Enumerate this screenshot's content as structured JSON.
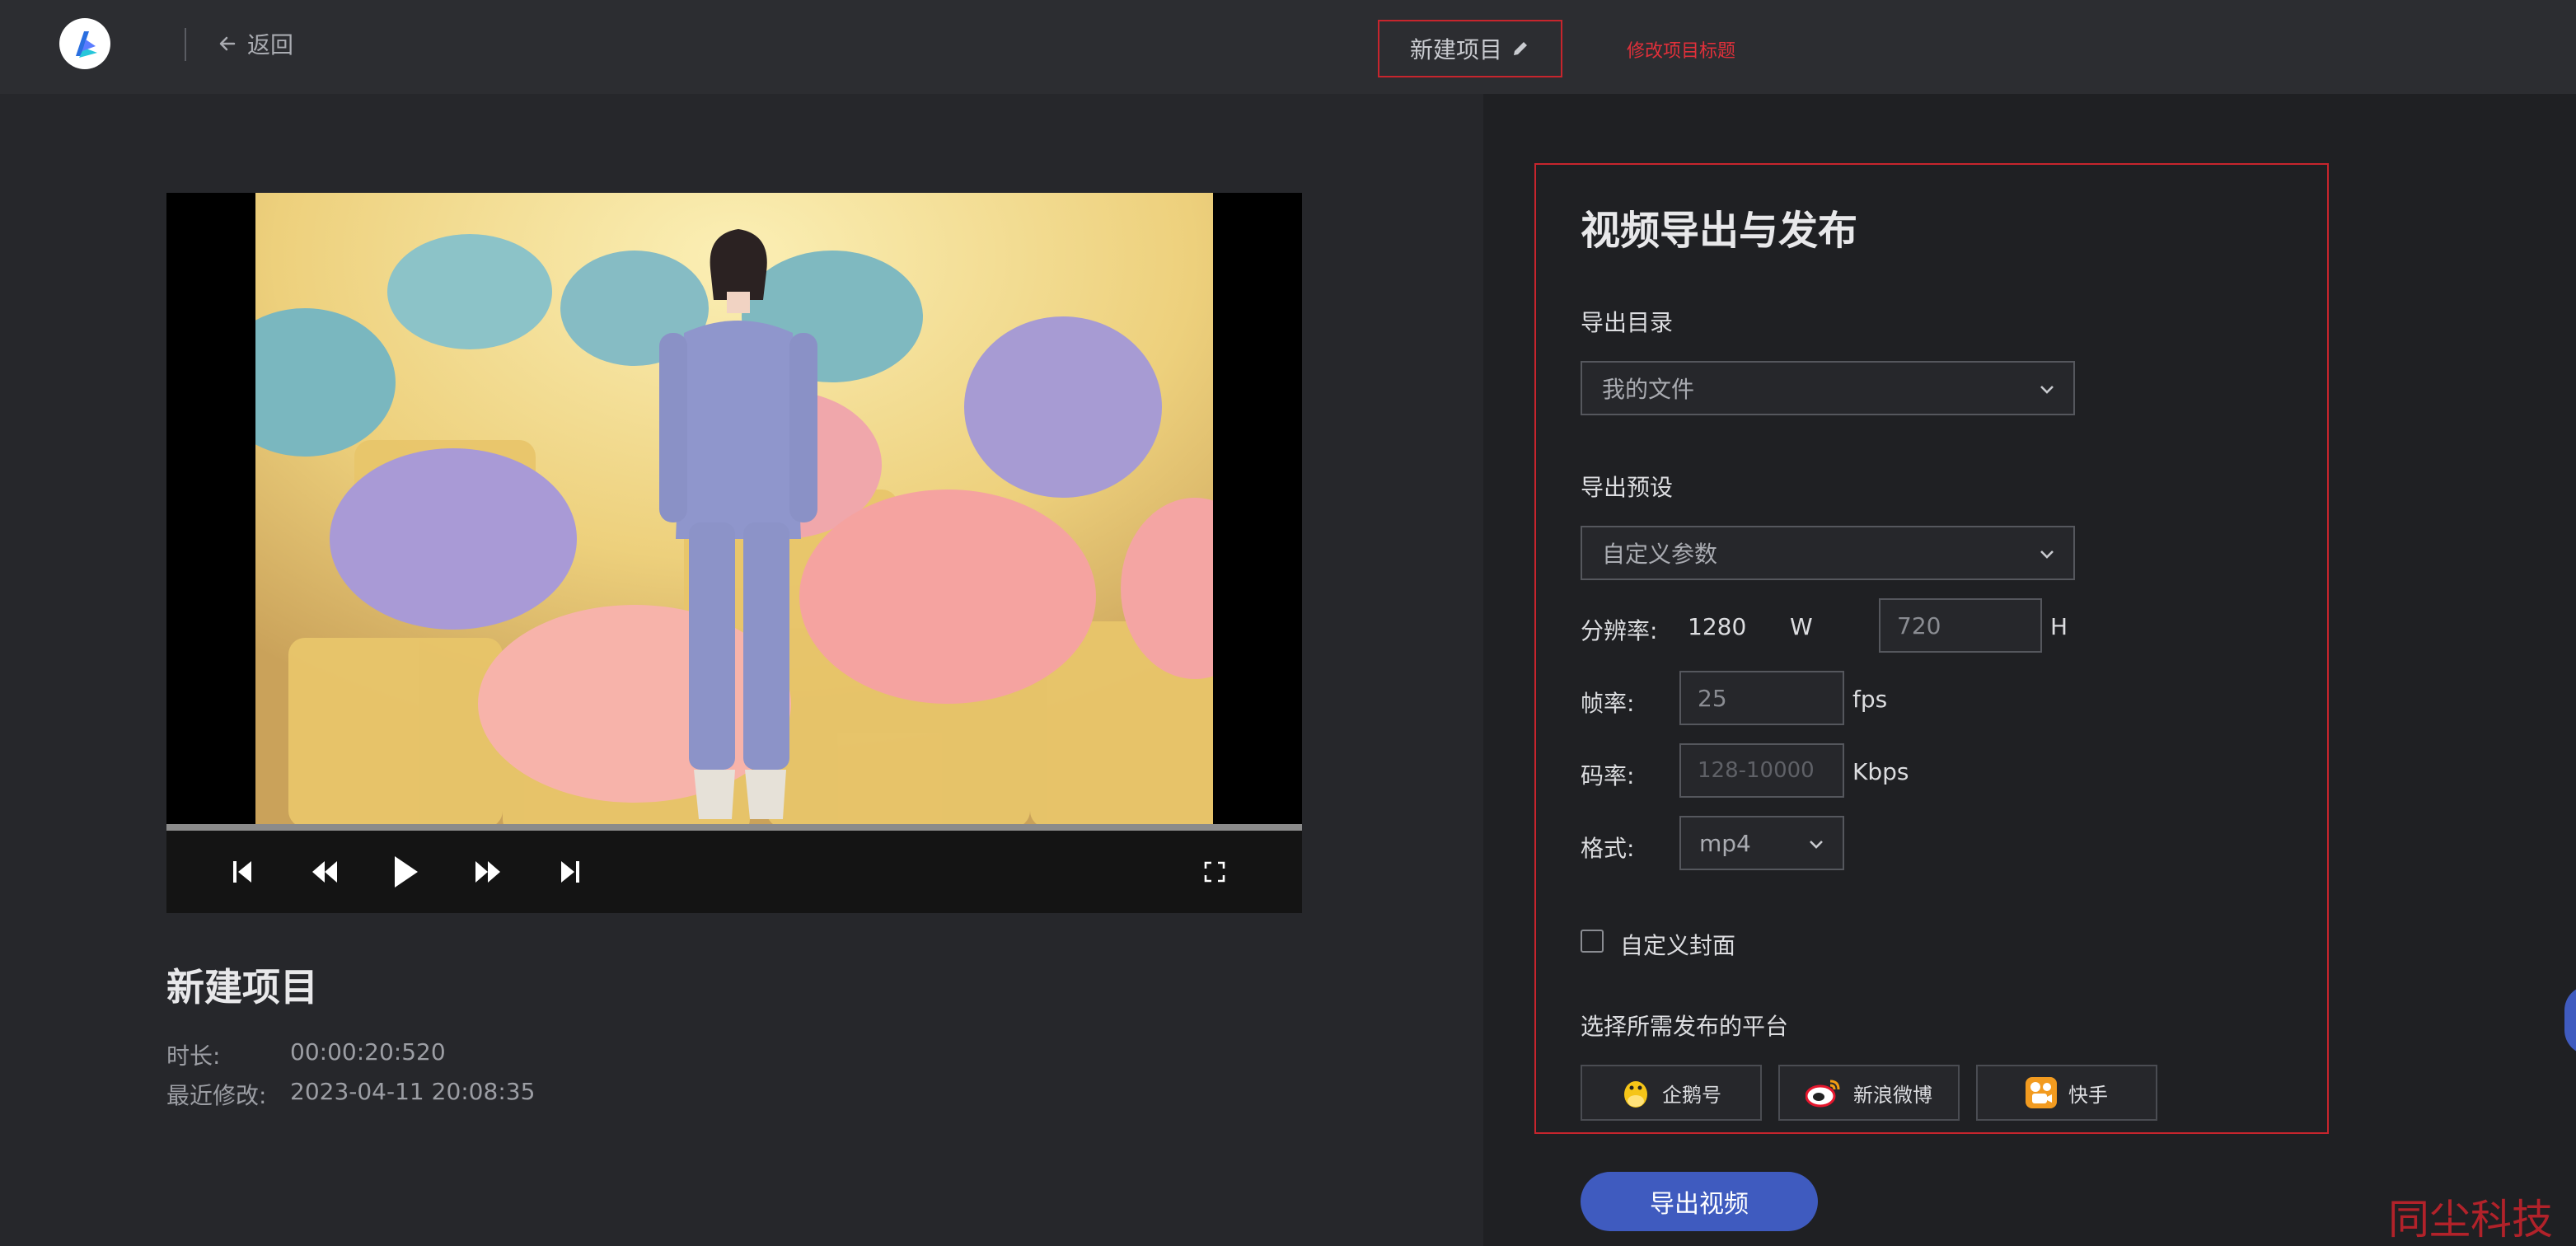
{
  "header": {
    "back_label": "返回",
    "project_title": "新建项目",
    "annotation": "修改项目标题"
  },
  "project": {
    "name": "新建项目",
    "duration_label": "时长:",
    "duration": "00:00:20:520",
    "modified_label": "最近修改:",
    "modified": "2023-04-11 20:08:35"
  },
  "publish": {
    "title": "视频导出与发布",
    "export_dir_label": "导出目录",
    "export_dir_value": "我的文件",
    "preset_label": "导出预设",
    "preset_value": "自定义参数",
    "resolution_label": "分辨率:",
    "width_value": "1280",
    "width_unit": "W",
    "height_value": "720",
    "height_unit": "H",
    "fps_label": "帧率:",
    "fps_value": "25",
    "fps_unit": "fps",
    "bitrate_label": "码率:",
    "bitrate_placeholder": "128-10000",
    "bitrate_unit": "Kbps",
    "format_label": "格式:",
    "format_value": "mp4",
    "cover_label": "自定义封面",
    "platform_label": "选择所需发布的平台",
    "platforms": [
      {
        "name": "企鹅号",
        "icon": "penguin-icon"
      },
      {
        "name": "新浪微博",
        "icon": "weibo-icon"
      },
      {
        "name": "快手",
        "icon": "kuaishou-icon"
      }
    ],
    "export_button": "导出视频"
  },
  "watermark": "同尘科技",
  "colors": {
    "accent": "#3f5bbf",
    "annotation_red": "#c7252d",
    "page_bg": "#26272b",
    "panel_bg": "#1f2023"
  }
}
